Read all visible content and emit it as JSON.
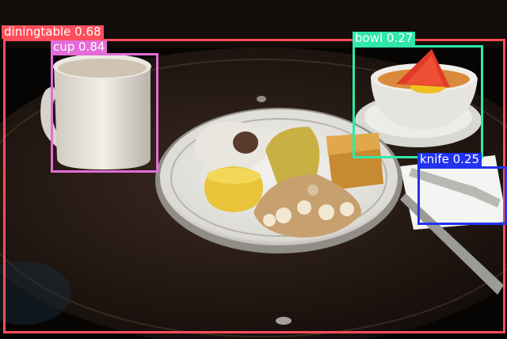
{
  "detections": [
    {
      "id": "diningtable",
      "label": "diningtable",
      "score": "0.68",
      "color": "#ff4d5a"
    },
    {
      "id": "cup",
      "label": "cup",
      "score": "0.84",
      "color": "#e46bd8"
    },
    {
      "id": "bowl",
      "label": "bowl",
      "score": "0.27",
      "color": "#2ee8a8"
    },
    {
      "id": "knife",
      "label": "knife",
      "score": "0.25",
      "color": "#2233ee"
    }
  ]
}
